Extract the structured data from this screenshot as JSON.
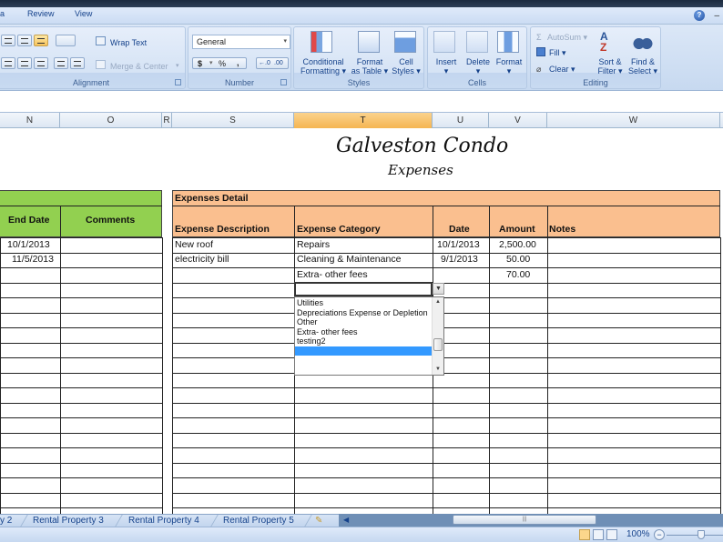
{
  "menu": {
    "tabs": [
      "a",
      "Review",
      "View"
    ]
  },
  "ribbon": {
    "alignment": {
      "label": "Alignment",
      "wrap_text": "Wrap Text",
      "merge_center": "Merge & Center"
    },
    "number": {
      "label": "Number",
      "format": "General",
      "currency": "$",
      "percent": "%",
      "comma": ","
    },
    "styles": {
      "label": "Styles",
      "conditional_formatting_1": "Conditional",
      "conditional_formatting_2": "Formatting",
      "format_table_1": "Format",
      "format_table_2": "as Table",
      "cell_styles_1": "Cell",
      "cell_styles_2": "Styles"
    },
    "cells": {
      "label": "Cells",
      "insert": "Insert",
      "delete": "Delete",
      "format": "Format"
    },
    "editing": {
      "label": "Editing",
      "autosum": "AutoSum",
      "fill": "Fill",
      "clear": "Clear",
      "sort_1": "Sort &",
      "sort_2": "Filter",
      "find_1": "Find &",
      "find_2": "Select"
    }
  },
  "columns": [
    "N",
    "O",
    "R",
    "S",
    "T",
    "U",
    "V",
    "W"
  ],
  "selected_column": "T",
  "sheet": {
    "title": "Galveston Condo",
    "subtitle": "Expenses",
    "left_table": {
      "headers": [
        "End Date",
        "Comments"
      ],
      "rows": [
        [
          "10/1/2013",
          ""
        ],
        [
          "11/5/2013",
          ""
        ]
      ]
    },
    "expenses": {
      "section_title": "Expenses Detail",
      "headers": [
        "Expense Description",
        "Expense Category",
        "Date",
        "Amount",
        "Notes"
      ],
      "rows": [
        [
          "New roof",
          "Repairs",
          "10/1/2013",
          "2,500.00",
          ""
        ],
        [
          "electricity bill",
          "Cleaning & Maintenance",
          "9/1/2013",
          "50.00",
          ""
        ],
        [
          "",
          "Extra- other fees",
          "",
          "70.00",
          ""
        ]
      ]
    },
    "category_dropdown": {
      "options": [
        "Utilities",
        "Depreciations Expense or Depletion",
        "Other",
        "Extra- other fees",
        "testing2",
        ""
      ],
      "highlighted_index": 5
    }
  },
  "sheet_tabs": [
    "y 2",
    "Rental Property 3",
    "Rental Property 4",
    "Rental Property 5"
  ],
  "status": {
    "zoom": "100%"
  }
}
